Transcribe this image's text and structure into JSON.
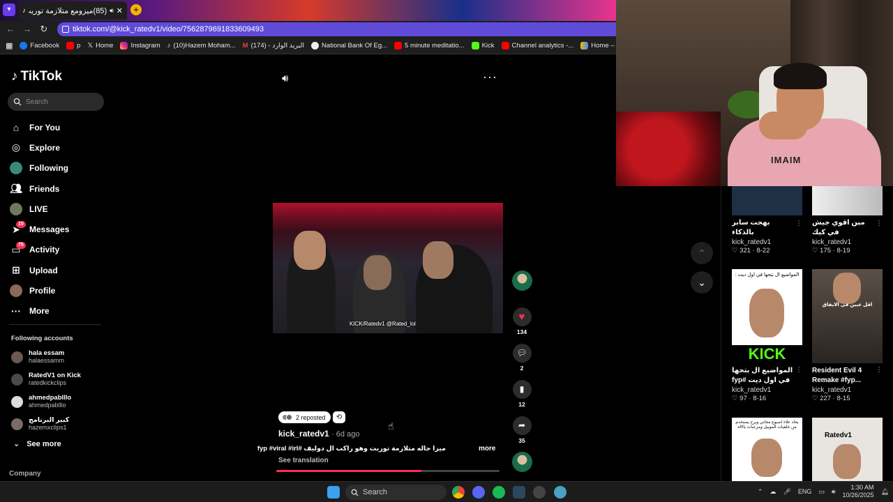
{
  "browser": {
    "tab_title": "(85)ميزومع متلازمة توريت خ",
    "url": "tiktok.com/@kick_ratedv1/video/7562879691833609493",
    "bookmarks": [
      "Facebook",
      "p",
      "Home",
      "Instagram",
      "(10)Hazem Moham...",
      "البريد الوارد - (174)",
      "National Bank Of Eg...",
      "5 minute meditatio...",
      "Kick",
      "Channel analytics -...",
      "Home – Google Ad..."
    ]
  },
  "sidebar": {
    "brand": "TikTok",
    "search_placeholder": "Search",
    "nav": [
      {
        "label": "For You"
      },
      {
        "label": "Explore"
      },
      {
        "label": "Following"
      },
      {
        "label": "Friends"
      },
      {
        "label": "LIVE"
      },
      {
        "label": "Messages",
        "badge": "10"
      },
      {
        "label": "Activity",
        "badge": "75"
      },
      {
        "label": "Upload"
      },
      {
        "label": "Profile"
      },
      {
        "label": "More"
      }
    ],
    "following_title": "Following accounts",
    "accounts": [
      {
        "name": "hala essam",
        "handle": "halaessamm"
      },
      {
        "name": "RatedV1 on Kick",
        "handle": "ratedkickclips"
      },
      {
        "name": "ahmedpablllo",
        "handle": "ahmedpablllo"
      },
      {
        "name": "كبير البرنامج",
        "handle": "hazemxclips1"
      }
    ],
    "see_more": "See more",
    "company": "Company"
  },
  "video": {
    "caption_overlay": "KICK/Ratedv1 @Rated_lol",
    "reposted": "2 reposted",
    "author": "kick_ratedv1",
    "ago": "· 6d ago",
    "description": "ميزا جاله متلازمة توريت وهو راكب ال دوليف #fyp #viral #irl",
    "more": "more",
    "see_translation": "See translation",
    "progress": 0.65
  },
  "actions": {
    "likes": "134",
    "comments": "2",
    "saves": "12",
    "shares": "35"
  },
  "grid": [
    {
      "title": "بهجت سابر بالذكاء الاسطناعي ...",
      "user": "kick_ratedv1",
      "likes": "321",
      "date": "8-22"
    },
    {
      "title": "مين اقوي جيش في كيك #ratedlive...",
      "user": "kick_ratedv1",
      "likes": "175",
      "date": "8-19"
    },
    {
      "title": "المواضيع ال بتحها في اول ديت #fyp #viral...",
      "user": "kick_ratedv1",
      "likes": "97",
      "date": "8-16",
      "thumb_text": "المواضيع ال بتحها في اول ديت :",
      "thumb_brand": "KICK"
    },
    {
      "title": "Resident Evil 4 Remake #fyp...",
      "user": "kick_ratedv1",
      "likes": "227",
      "date": "8-15",
      "thumb_text": "اقل عبين في الايفاق"
    },
    {
      "title": "",
      "user": "",
      "likes": "",
      "date": "",
      "thumb_text": "يحاد علاء اسبوع مجاني ويرح يستخدم من خلفيات الموبيل ومرعبات يااااه"
    },
    {
      "title": "",
      "user": "",
      "likes": "",
      "date": "",
      "thumb_brand": "Ratedv1"
    }
  ],
  "taskbar": {
    "search": "Search",
    "lang": "ENG",
    "time": "1:30 AM",
    "date": "10/26/2025"
  },
  "webcam": {
    "shirt_text": "IMAIM"
  }
}
